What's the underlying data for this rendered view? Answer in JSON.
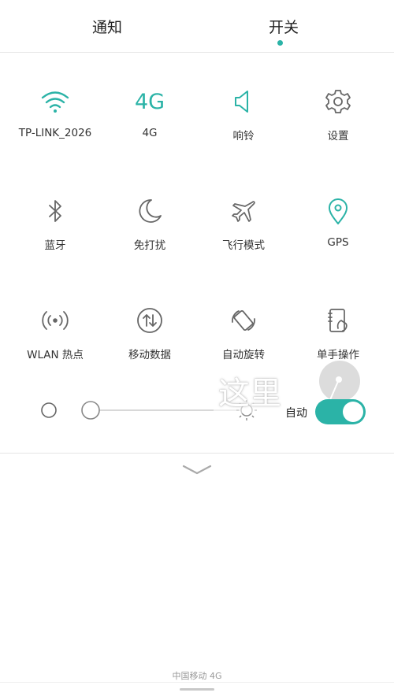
{
  "tabs": [
    {
      "label": "通知",
      "active": false
    },
    {
      "label": "开关",
      "active": true
    }
  ],
  "accent_color": "#2bb3a7",
  "toggles": [
    {
      "label": "TP-LINK_2026",
      "icon": "wifi-icon",
      "active": true
    },
    {
      "label": "4G",
      "icon": "4g-text-icon",
      "icon_text": "4G",
      "active": true
    },
    {
      "label": "响铃",
      "icon": "speaker-icon",
      "active": true
    },
    {
      "label": "设置",
      "icon": "gear-icon",
      "active": false
    },
    {
      "label": "蓝牙",
      "icon": "bluetooth-icon",
      "active": false
    },
    {
      "label": "免打扰",
      "icon": "moon-icon",
      "active": false
    },
    {
      "label": "飞行模式",
      "icon": "airplane-icon",
      "active": false
    },
    {
      "label": "GPS",
      "icon": "location-pin-icon",
      "active": true
    },
    {
      "label": "WLAN 热点",
      "icon": "hotspot-icon",
      "active": false
    },
    {
      "label": "移动数据",
      "icon": "data-arrows-icon",
      "active": false
    },
    {
      "label": "自动旋转",
      "icon": "rotate-icon",
      "active": false
    },
    {
      "label": "单手操作",
      "icon": "one-hand-icon",
      "active": false
    }
  ],
  "brightness": {
    "auto_label": "自动",
    "auto_enabled": true
  },
  "annotation": {
    "text": "这里"
  },
  "status": {
    "carrier": "中国移动 4G"
  }
}
